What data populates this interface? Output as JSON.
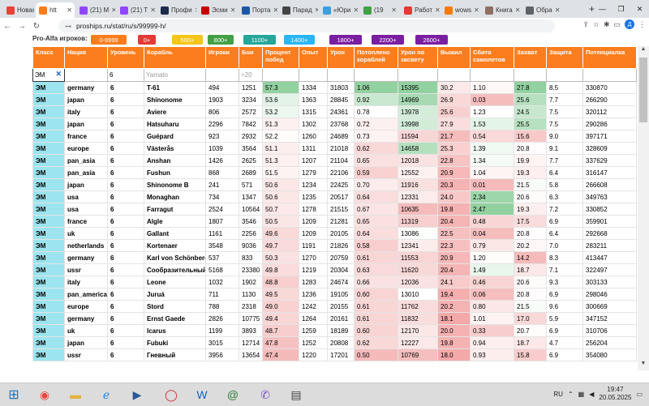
{
  "browser": {
    "tabs": [
      {
        "label": "Новая",
        "color": "#e94235"
      },
      {
        "label": "htt",
        "color": "#fb7d1d",
        "active": true
      },
      {
        "label": "(21) M",
        "color": "#9146ff"
      },
      {
        "label": "(21) T",
        "color": "#9146ff"
      },
      {
        "label": "Профи",
        "color": "#1c2b4a"
      },
      {
        "label": "Эсми",
        "color": "#c60000"
      },
      {
        "label": "Порта",
        "color": "#1c57a5"
      },
      {
        "label": "Парад",
        "color": "#444444"
      },
      {
        "label": "«Юри",
        "color": "#3aa0e0"
      },
      {
        "label": "(19",
        "color": "#43a047"
      },
      {
        "label": "Работ",
        "color": "#e53935"
      },
      {
        "label": "wows",
        "color": "#f57c00"
      },
      {
        "label": "Книга",
        "color": "#8d6e63"
      },
      {
        "label": "Обра",
        "color": "#5f6368"
      }
    ],
    "url": "proships.ru/stat/ru/s/99999-h/",
    "profile_initial": "Д"
  },
  "filters": {
    "label": "Pro-Alfa игроков:",
    "buttons": [
      {
        "label": "0-9999",
        "color": "#fb7d1d"
      },
      {
        "label": "0+",
        "color": "#e53935"
      },
      {
        "label": "500+",
        "color": "#f5c518"
      },
      {
        "label": "800+",
        "color": "#43a047"
      },
      {
        "label": "1100+",
        "color": "#26a69a"
      },
      {
        "label": "1400+",
        "color": "#29b6f6"
      },
      {
        "label": "1800+",
        "color": "#7b1fa2"
      },
      {
        "label": "2200+",
        "color": "#7b1fa2"
      },
      {
        "label": "2600+",
        "color": "#7b1fa2"
      }
    ]
  },
  "table": {
    "headers": [
      "Класс",
      "Нация",
      "Уровень",
      "Корабль",
      "Игроки",
      "Бои",
      "Процент побед",
      "Опыт",
      "Урон",
      "Потоплено кораблей",
      "Урон по засвету",
      "Выжил",
      "Сбито самолетов",
      "Захват",
      "Защита",
      "Потенциалка"
    ],
    "filter_values": [
      "ЭМ",
      "",
      "6",
      "",
      "",
      "",
      "",
      "",
      "",
      "",
      "",
      "",
      "",
      "",
      "",
      ""
    ],
    "filter_placeholders": [
      "",
      "",
      "",
      "Yamato",
      "",
      ">20",
      "",
      "",
      "",
      "",
      "",
      "",
      "",
      "",
      "",
      ""
    ],
    "rows": [
      [
        "ЭМ",
        "germany",
        "6",
        "T-61",
        "494",
        "1251",
        "57.3",
        "1334",
        "31803",
        "1.06",
        "15395",
        "30.2",
        "1.10",
        "27.8",
        "8.5",
        "330870"
      ],
      [
        "ЭМ",
        "japan",
        "6",
        "Shinonome",
        "1903",
        "3234",
        "53.6",
        "1363",
        "28845",
        "0.92",
        "14969",
        "26.9",
        "0.03",
        "25.6",
        "7.7",
        "266290"
      ],
      [
        "ЭМ",
        "italy",
        "6",
        "Aviere",
        "806",
        "2572",
        "53.2",
        "1315",
        "24361",
        "0.78",
        "13978",
        "25.6",
        "1.23",
        "24.5",
        "7.5",
        "320112"
      ],
      [
        "ЭМ",
        "japan",
        "6",
        "Hatsuharu",
        "2296",
        "7842",
        "51.3",
        "1302",
        "23768",
        "0.72",
        "13998",
        "27.9",
        "1.53",
        "25.5",
        "7.5",
        "290286"
      ],
      [
        "ЭМ",
        "france",
        "6",
        "Guépard",
        "923",
        "2932",
        "52.2",
        "1260",
        "24689",
        "0.73",
        "11594",
        "21.7",
        "0.54",
        "15.6",
        "9.0",
        "397171"
      ],
      [
        "ЭМ",
        "europe",
        "6",
        "Västerås",
        "1039",
        "3564",
        "51.1",
        "1311",
        "21018",
        "0.62",
        "14658",
        "25.3",
        "1.39",
        "20.8",
        "9.1",
        "328609"
      ],
      [
        "ЭМ",
        "pan_asia",
        "6",
        "Anshan",
        "1426",
        "2625",
        "51.3",
        "1207",
        "21104",
        "0.65",
        "12018",
        "22.8",
        "1.34",
        "19.9",
        "7.7",
        "337629"
      ],
      [
        "ЭМ",
        "pan_asia",
        "6",
        "Fushun",
        "868",
        "2689",
        "51.5",
        "1279",
        "22106",
        "0.59",
        "12552",
        "20.9",
        "1.04",
        "19.3",
        "6.4",
        "316147"
      ],
      [
        "ЭМ",
        "japan",
        "6",
        "Shinonome B",
        "241",
        "571",
        "50.6",
        "1234",
        "22425",
        "0.70",
        "11916",
        "20.3",
        "0.01",
        "21.5",
        "5.8",
        "266608"
      ],
      [
        "ЭМ",
        "usa",
        "6",
        "Monaghan",
        "734",
        "1347",
        "50.6",
        "1235",
        "20517",
        "0.64",
        "12331",
        "24.0",
        "2.34",
        "20.6",
        "6.3",
        "349763"
      ],
      [
        "ЭМ",
        "usa",
        "6",
        "Farragut",
        "2524",
        "10564",
        "50.7",
        "1278",
        "21515",
        "0.67",
        "10635",
        "19.8",
        "2.47",
        "19.3",
        "7.2",
        "330852"
      ],
      [
        "ЭМ",
        "france",
        "6",
        "Algle",
        "1807",
        "3546",
        "50.5",
        "1209",
        "21281",
        "0.65",
        "11319",
        "20.4",
        "0.48",
        "17.5",
        "6.9",
        "359901"
      ],
      [
        "ЭМ",
        "uk",
        "6",
        "Gallant",
        "1161",
        "2256",
        "49.6",
        "1209",
        "20105",
        "0.64",
        "13086",
        "22.5",
        "0.04",
        "20.8",
        "6.4",
        "292668"
      ],
      [
        "ЭМ",
        "netherlands",
        "6",
        "Kortenaer",
        "3548",
        "9036",
        "49.7",
        "1191",
        "21826",
        "0.58",
        "12341",
        "22.3",
        "0.79",
        "20.2",
        "7.0",
        "283211"
      ],
      [
        "ЭМ",
        "germany",
        "6",
        "Karl von Schönberg",
        "537",
        "833",
        "50.3",
        "1270",
        "20759",
        "0.61",
        "11553",
        "20.9",
        "1.20",
        "14.2",
        "8.3",
        "413447"
      ],
      [
        "ЭМ",
        "ussr",
        "6",
        "Сообразительный",
        "5168",
        "23380",
        "49.8",
        "1219",
        "20304",
        "0.63",
        "11620",
        "20.4",
        "1.49",
        "18.7",
        "7.1",
        "322497"
      ],
      [
        "ЭМ",
        "italy",
        "6",
        "Leone",
        "1032",
        "1902",
        "48.8",
        "1283",
        "24674",
        "0.66",
        "12036",
        "24.1",
        "0.46",
        "20.6",
        "9.3",
        "303133"
      ],
      [
        "ЭМ",
        "pan_america",
        "6",
        "Juruá",
        "711",
        "1130",
        "49.5",
        "1236",
        "19105",
        "0.60",
        "13010",
        "19.4",
        "0.06",
        "20.8",
        "6.9",
        "298046"
      ],
      [
        "ЭМ",
        "europe",
        "6",
        "Stord",
        "788",
        "2318",
        "49.0",
        "1242",
        "20155",
        "0.61",
        "11762",
        "20.2",
        "0.80",
        "21.5",
        "9.6",
        "300669"
      ],
      [
        "ЭМ",
        "germany",
        "6",
        "Ernst Gaede",
        "2826",
        "10775",
        "49.4",
        "1264",
        "20161",
        "0.61",
        "11832",
        "18.1",
        "1.01",
        "17.0",
        "5.9",
        "347152"
      ],
      [
        "ЭМ",
        "uk",
        "6",
        "Icarus",
        "1199",
        "3893",
        "48.7",
        "1259",
        "18189",
        "0.60",
        "12170",
        "20.0",
        "0.33",
        "20.7",
        "6.9",
        "310706"
      ],
      [
        "ЭМ",
        "japan",
        "6",
        "Fubuki",
        "3015",
        "12714",
        "47.8",
        "1252",
        "20808",
        "0.62",
        "12227",
        "19.8",
        "0.94",
        "18.7",
        "4.7",
        "256204"
      ],
      [
        "ЭМ",
        "ussr",
        "6",
        "Гневный",
        "3956",
        "13654",
        "47.4",
        "1220",
        "17201",
        "0.50",
        "10769",
        "18.0",
        "0.93",
        "15.8",
        "6.9",
        "354080"
      ]
    ]
  },
  "taskbar": {
    "language": "RU",
    "time": "19:47",
    "date": "20.05.2025"
  }
}
